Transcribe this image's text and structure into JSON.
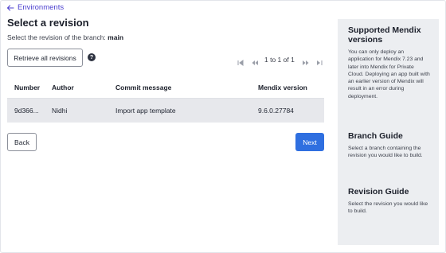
{
  "nav": {
    "back_label": "Environments"
  },
  "page": {
    "title": "Select a revision",
    "subtitle_prefix": "Select the revision of the branch:",
    "branch_name": "main"
  },
  "toolbar": {
    "retrieve_label": "Retrieve all revisions",
    "help_glyph": "?"
  },
  "pagination": {
    "text": "1 to 1 of 1",
    "icons": [
      "first-page-icon",
      "previous-page-icon",
      "next-page-icon",
      "last-page-icon"
    ]
  },
  "table": {
    "columns": [
      "Number",
      "Author",
      "Commit message",
      "Mendix version"
    ],
    "rows": [
      {
        "number": "9d366...",
        "author": "Nidhi",
        "commit_message": "Import app template",
        "mendix_version": "9.6.0.27784"
      }
    ]
  },
  "actions": {
    "back_label": "Back",
    "next_label": "Next"
  },
  "sidebar": {
    "sections": [
      {
        "title": "Supported Mendix versions",
        "body": "You can only deploy an application for Mendix 7.23 and later into Mendix for Private Cloud. Deploying an app built with an earlier version of Mendix will result in an error during deployment."
      },
      {
        "title": "Branch Guide",
        "body": "Select a branch containing the revision you would like to build."
      },
      {
        "title": "Revision Guide",
        "body": "Select the revision you would like to build."
      }
    ]
  },
  "colors": {
    "accent": "#4b3fcf",
    "primary_button": "#2f6fe0",
    "selected_row": "#e7e8ec",
    "sidebar_bg": "#eceef1"
  }
}
